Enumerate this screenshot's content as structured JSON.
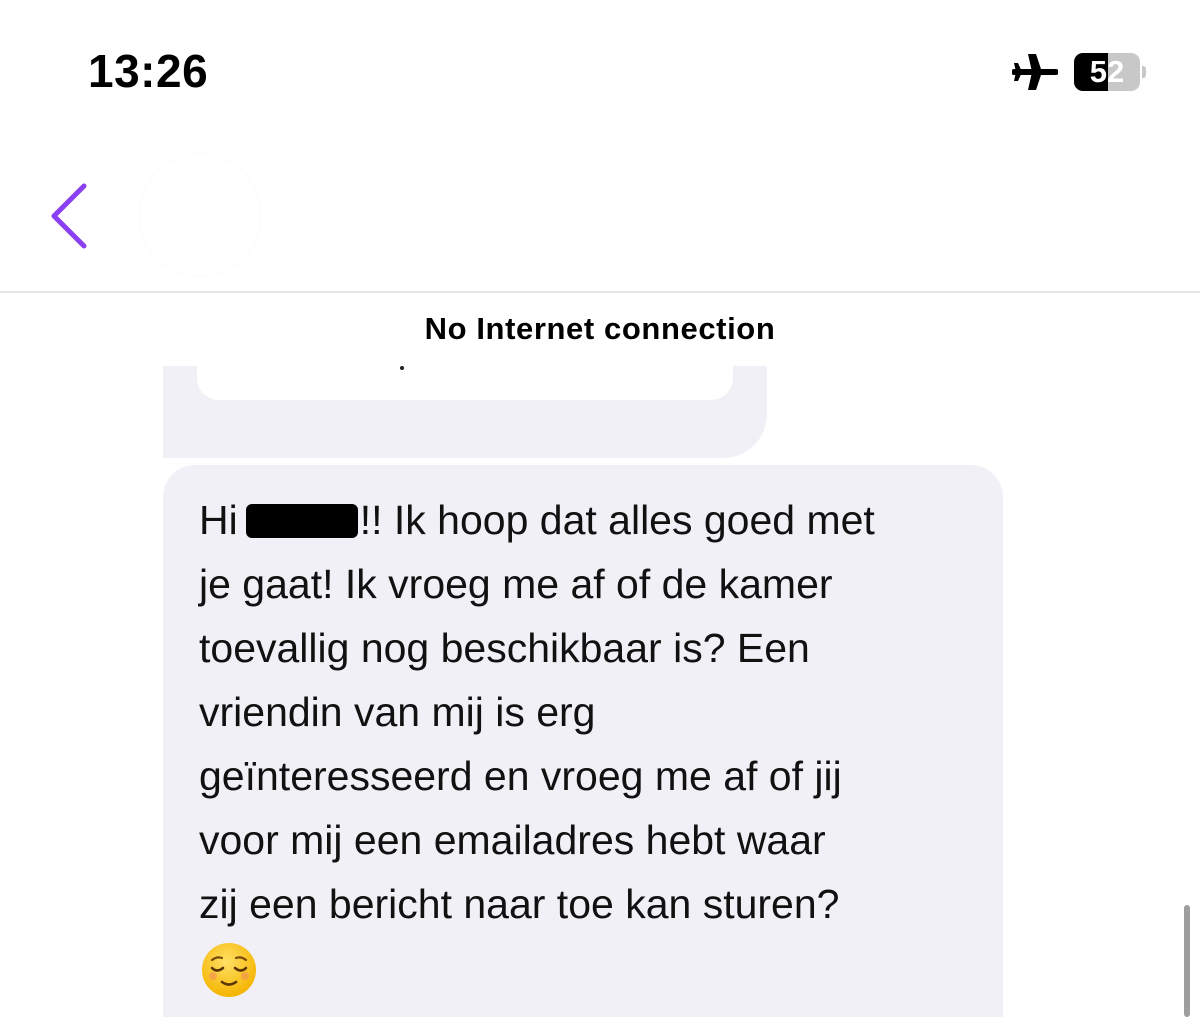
{
  "status_bar": {
    "time": "13:26",
    "mode_icon": "airplane-icon",
    "battery": {
      "level_text": "52",
      "level": 0.52
    }
  },
  "nav": {
    "back_icon": "chevron-left-icon",
    "accent_color": "#8a3ff0"
  },
  "banner": {
    "text": "No Internet connection"
  },
  "message": {
    "lines": [
      {
        "before": "Hi",
        "after": "!! Ik hoop dat alles goed met"
      },
      "je gaat! Ik vroeg me af of de kamer",
      "toevallig nog beschikbaar is? Een",
      "vriendin van mij is erg",
      "geïnteresseerd en vroeg me af of jij",
      "voor mij een emailadres hebt waar",
      "zij een bericht naar toe kan sturen?"
    ],
    "emoji": "relieved-face-icon",
    "bubble_color": "#f1f0f6"
  }
}
